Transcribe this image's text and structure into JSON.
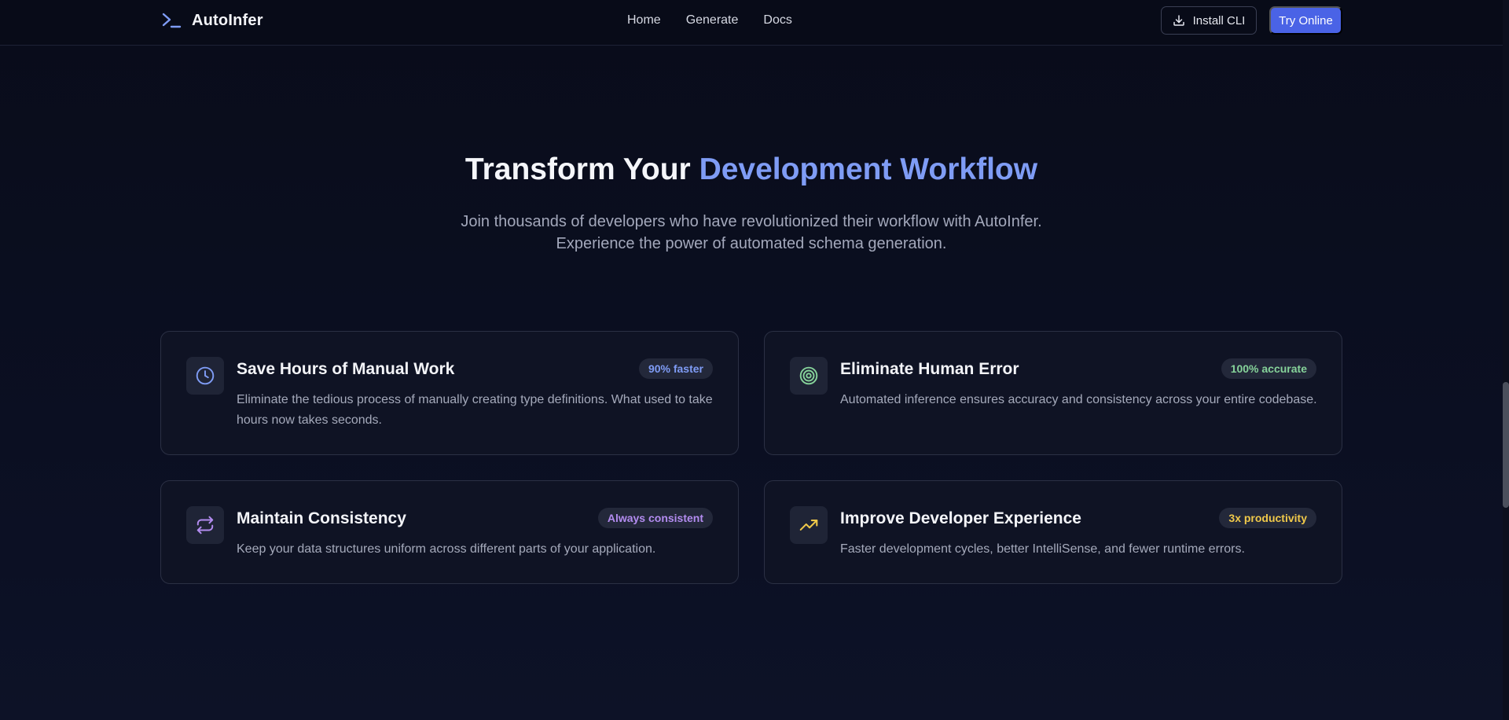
{
  "header": {
    "brand": "AutoInfer",
    "nav": [
      {
        "label": "Home"
      },
      {
        "label": "Generate"
      },
      {
        "label": "Docs"
      }
    ],
    "install_label": "Install CLI",
    "try_label": "Try Online"
  },
  "hero": {
    "title_plain": "Transform Your",
    "title_accent": "Development Workflow",
    "subtitle": "Join thousands of developers who have revolutionized their workflow with AutoInfer. Experience the power of automated schema generation."
  },
  "colors": {
    "accent": "#7f9cf5",
    "primary_button": "#4a63e6",
    "badge_blue": "#7f9cf5",
    "badge_green": "#86d39a",
    "badge_purple": "#b38cf0",
    "badge_yellow": "#f0c94a"
  },
  "features": [
    {
      "icon": "clock-icon",
      "title": "Save Hours of Manual Work",
      "badge": "90% faster",
      "description": "Eliminate the tedious process of manually creating type definitions. What used to take hours now takes seconds."
    },
    {
      "icon": "target-icon",
      "title": "Eliminate Human Error",
      "badge": "100% accurate",
      "description": "Automated inference ensures accuracy and consistency across your entire codebase."
    },
    {
      "icon": "repeat-icon",
      "title": "Maintain Consistency",
      "badge": "Always consistent",
      "description": "Keep your data structures uniform across different parts of your application."
    },
    {
      "icon": "trending-up-icon",
      "title": "Improve Developer Experience",
      "badge": "3x productivity",
      "description": "Faster development cycles, better IntelliSense, and fewer runtime errors."
    }
  ]
}
